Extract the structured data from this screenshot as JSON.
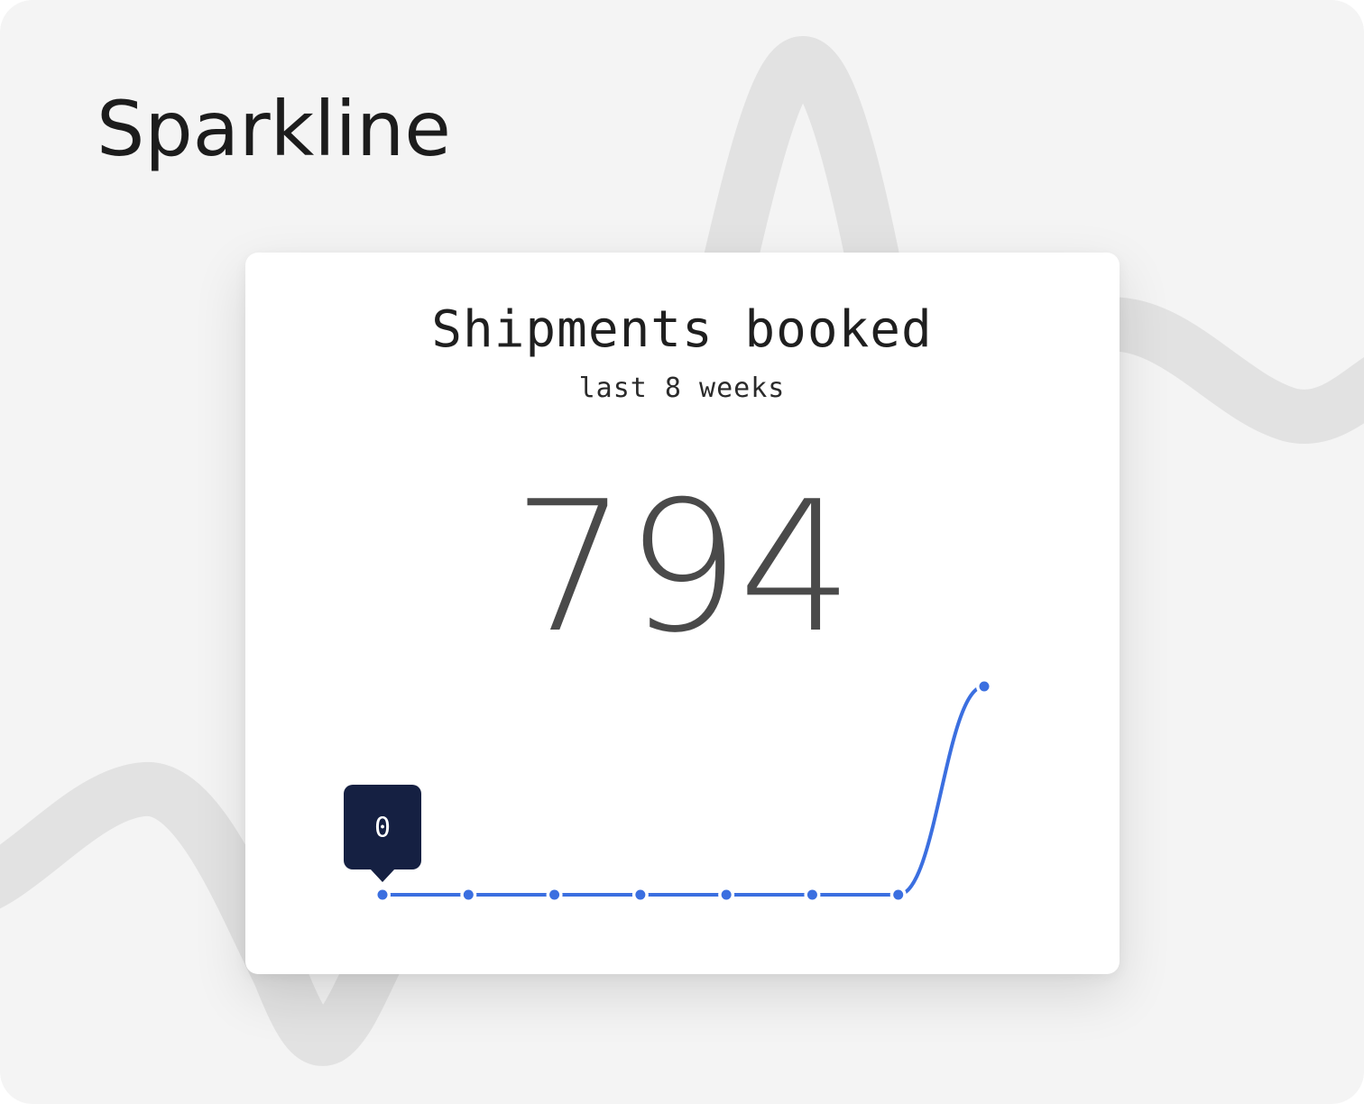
{
  "page": {
    "title": "Sparkline"
  },
  "card": {
    "title": "Shipments booked",
    "subtitle": "last 8 weeks",
    "value": "794"
  },
  "tooltip": {
    "label": "0",
    "point_index": 0
  },
  "colors": {
    "background": "#f4f4f4",
    "card": "#ffffff",
    "line": "#3b6fe0",
    "tooltip_bg": "#152042",
    "tooltip_text": "#ffffff",
    "wave": "#e2e2e2"
  },
  "chart_data": {
    "type": "line",
    "title": "Shipments booked",
    "subtitle": "last 8 weeks",
    "x": [
      1,
      2,
      3,
      4,
      5,
      6,
      7,
      8
    ],
    "values": [
      0,
      0,
      0,
      0,
      0,
      0,
      0,
      794
    ],
    "ylim": [
      0,
      794
    ],
    "grid": false,
    "smooth": true,
    "markers": true
  }
}
